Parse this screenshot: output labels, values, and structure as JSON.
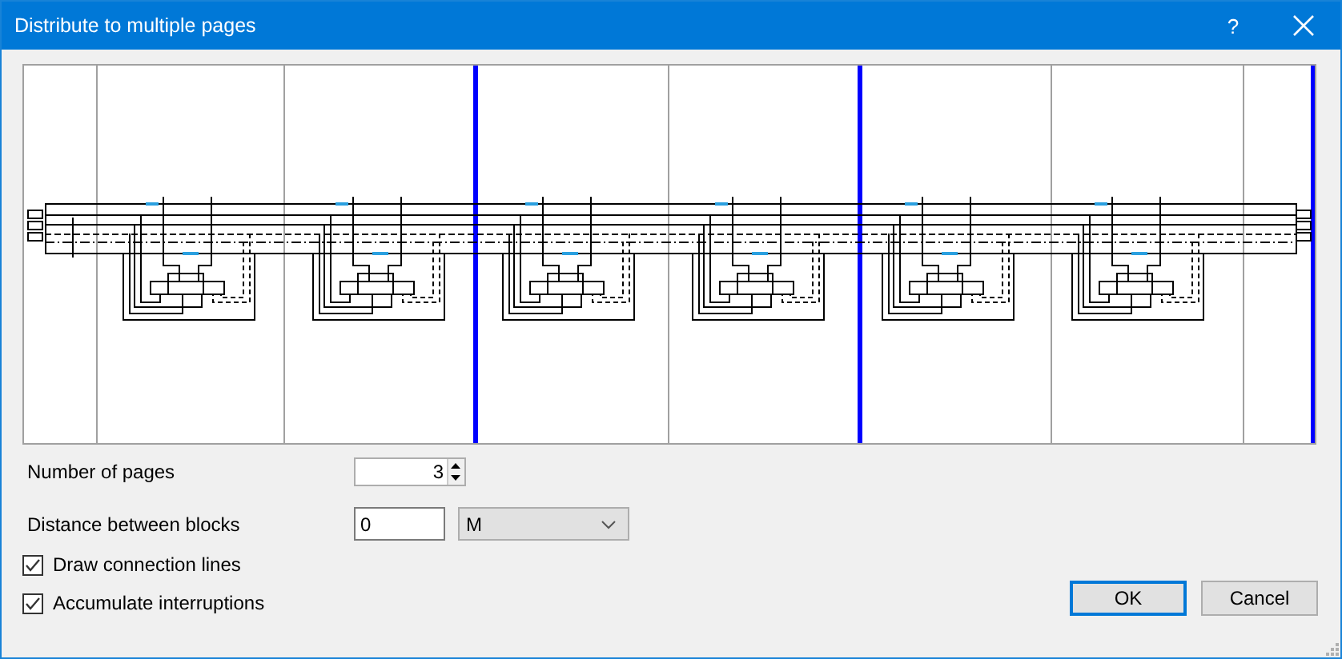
{
  "window": {
    "title": "Distribute to multiple pages",
    "help_button": "?"
  },
  "number_of_pages": {
    "label": "Number of pages",
    "value": "3"
  },
  "distance_between_blocks": {
    "label": "Distance between blocks",
    "value": "0",
    "unit": "M"
  },
  "checkboxes": [
    {
      "label": "Draw connection lines",
      "checked": true
    },
    {
      "label": "Accumulate interruptions",
      "checked": true
    }
  ],
  "buttons": [
    {
      "label": "OK",
      "default": true
    },
    {
      "label": "Cancel",
      "default": false
    }
  ]
}
